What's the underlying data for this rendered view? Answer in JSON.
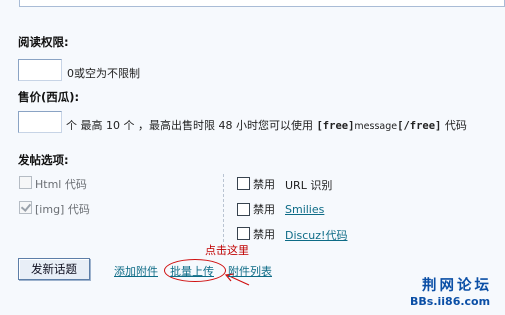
{
  "read_permission": {
    "heading": "阅读权限:",
    "value": "",
    "hint": "0或空为不限制"
  },
  "price": {
    "heading": "售价(西瓜):",
    "value": "",
    "desc_a": "个  最高  10 个 ，最高出售时限  48 小时您可以使用 ",
    "tag_open": "[free]",
    "tag_mid": "message",
    "tag_close": "[/free]",
    "desc_b": " 代码"
  },
  "post_options": {
    "heading": "发帖选项:",
    "left": [
      {
        "label": "Html 代码",
        "checked": false,
        "disabled": true
      },
      {
        "label": "[img] 代码",
        "checked": true,
        "disabled": true
      }
    ],
    "right": [
      {
        "prefix": "禁用",
        "label": "URL 识别",
        "is_link": false,
        "checked": false
      },
      {
        "prefix": "禁用",
        "label": "Smilies",
        "is_link": true,
        "checked": false
      },
      {
        "prefix": "禁用",
        "label": "Discuz!代码",
        "is_link": true,
        "checked": false
      }
    ]
  },
  "actions": {
    "submit": "发新话题",
    "add_attachment": "添加附件",
    "batch_upload": "批量上传",
    "attachment_list": "附件列表"
  },
  "annotation": {
    "text": "点击这里",
    "color": "#c00000"
  },
  "watermark": {
    "title": "荆网论坛",
    "url": "BBs.ii86.com",
    "color": "#0b4fa6"
  }
}
